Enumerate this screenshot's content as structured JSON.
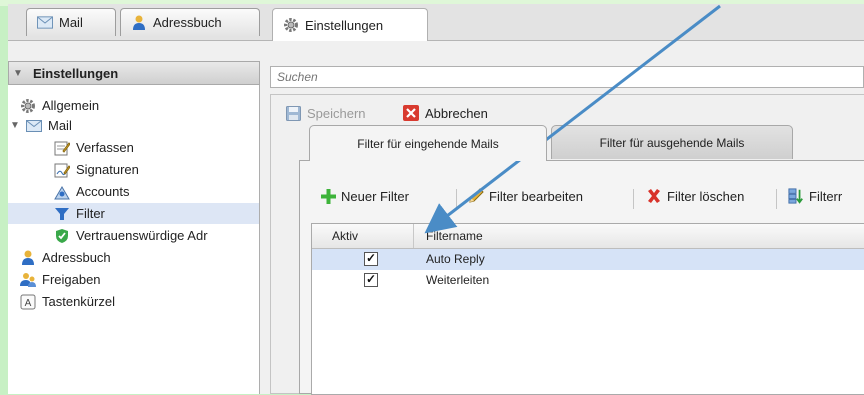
{
  "tabs": [
    {
      "label": "Mail",
      "icon": "envelope-icon"
    },
    {
      "label": "Adressbuch",
      "icon": "person-icon"
    },
    {
      "label": "Einstellungen",
      "icon": "gear-icon"
    }
  ],
  "sidebar": {
    "title": "Einstellungen",
    "items": [
      {
        "label": "Allgemein",
        "icon": "gear-icon"
      },
      {
        "label": "Mail",
        "icon": "envelope-icon"
      },
      {
        "label": "Verfassen",
        "icon": "compose-icon"
      },
      {
        "label": "Signaturen",
        "icon": "signature-icon"
      },
      {
        "label": "Accounts",
        "icon": "accounts-icon"
      },
      {
        "label": "Filter",
        "icon": "filter-icon"
      },
      {
        "label": "Vertrauenswürdige Adr",
        "icon": "shield-icon"
      },
      {
        "label": "Adressbuch",
        "icon": "person-icon"
      },
      {
        "label": "Freigaben",
        "icon": "share-icon"
      },
      {
        "label": "Tastenkürzel",
        "icon": "keyboard-icon"
      }
    ]
  },
  "search": {
    "placeholder": "Suchen"
  },
  "toolbar": {
    "save_label": "Speichern",
    "cancel_label": "Abbrechen"
  },
  "filter_tabs": [
    "Filter für eingehende Mails",
    "Filter für ausgehende Mails"
  ],
  "filter_toolbar": {
    "new_label": "Neuer Filter",
    "edit_label": "Filter bearbeiten",
    "delete_label": "Filter löschen",
    "order_label": "Filterr"
  },
  "table": {
    "headers": [
      "Aktiv",
      "Filtername"
    ],
    "rows": [
      {
        "active": true,
        "name": "Auto Reply"
      },
      {
        "active": true,
        "name": "Weiterleiten"
      }
    ]
  },
  "colors": {
    "selection": "#dde6f5",
    "accent": "#4a8cc6",
    "background": "#c7f0c4"
  }
}
